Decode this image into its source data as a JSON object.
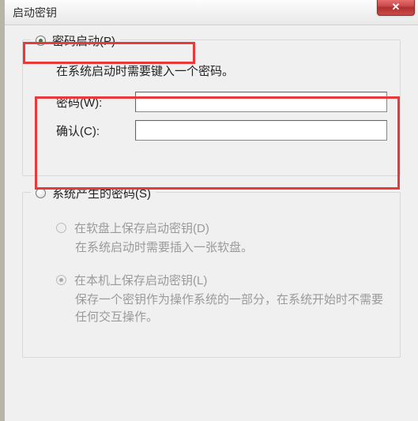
{
  "window": {
    "title": "启动密钥",
    "close_glyph": "✕"
  },
  "group_password": {
    "legend": "密码启动(P)",
    "desc": "在系统启动时需要键入一个密码。",
    "password_label": "密码(W):",
    "password_value": "",
    "confirm_label": "确认(C):",
    "confirm_value": ""
  },
  "group_system": {
    "legend": "系统产生的密码(S)",
    "opt_floppy_label": "在软盘上保存启动密钥(D)",
    "opt_floppy_desc": "在系统启动时需要插入一张软盘。",
    "opt_local_label": "在本机上保存启动密钥(L)",
    "opt_local_desc": "保存一个密钥作为操作系统的一部分，在系统开始时不需要任何交互操作。"
  }
}
